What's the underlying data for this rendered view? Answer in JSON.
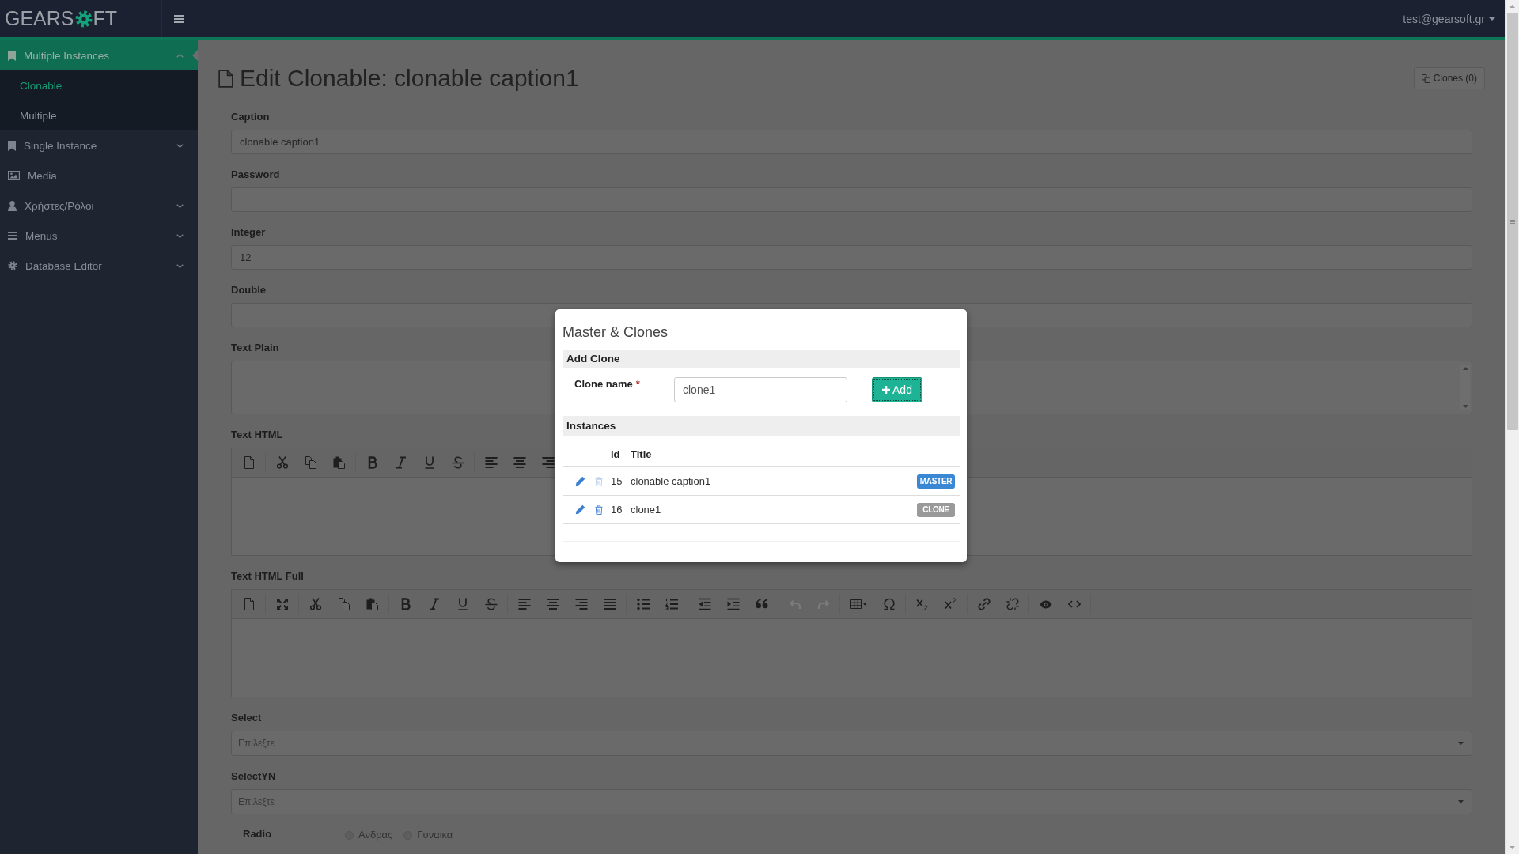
{
  "topbar": {
    "brand": {
      "text_start": "GEARS",
      "text_end": "FT"
    },
    "user_menu": "test@gearsoft.gr"
  },
  "sidebar": {
    "items": [
      {
        "label": "Multiple Instances",
        "kind": "group",
        "selected": true,
        "expanded": true,
        "children": [
          {
            "label": "Clonable",
            "selected": true
          },
          {
            "label": "Multiple",
            "selected": false
          }
        ]
      },
      {
        "label": "Single Instance",
        "kind": "group",
        "selected": false,
        "expanded": false
      },
      {
        "label": "Media",
        "kind": "link",
        "selected": false
      },
      {
        "label": "Χρήστες/Ρόλοι",
        "kind": "group",
        "selected": false,
        "expanded": false
      },
      {
        "label": "Menus",
        "kind": "group",
        "selected": false,
        "expanded": false
      },
      {
        "label": "Database Editor",
        "kind": "group",
        "selected": false,
        "expanded": false
      }
    ]
  },
  "page": {
    "title": "Edit Clonable: clonable caption1",
    "clones_button": "Clones (0)"
  },
  "form": {
    "fields": [
      {
        "label": "Caption",
        "kind": "input",
        "value": "clonable caption1"
      },
      {
        "label": "Password",
        "kind": "input"
      },
      {
        "label": "Integer",
        "kind": "input",
        "value": "12"
      },
      {
        "label": "Double",
        "kind": "input"
      },
      {
        "label": "Text Plain",
        "kind": "textarea"
      },
      {
        "label": "Text HTML",
        "kind": "editor"
      },
      {
        "label": "Text HTML Full",
        "kind": "editor_full",
        "undo": {
          "disabled": true
        },
        "redo": {
          "disabled": true
        }
      },
      {
        "label": "Select",
        "kind": "select",
        "placeholder": "Επιλεξτε"
      },
      {
        "label": "SelectYN",
        "kind": "select",
        "placeholder": "Επιλεξτε"
      },
      {
        "label": "Radio",
        "kind": "radio",
        "options": [
          {
            "label": "Ανδρας",
            "selected": false
          },
          {
            "label": "Γυναικα",
            "selected": false
          }
        ]
      }
    ]
  },
  "modal": {
    "title": "Master & Clones",
    "add_clone": {
      "heading": "Add Clone",
      "label": "Clone name",
      "required_mark": "*",
      "value": "clone1",
      "button": {
        "label": "Add",
        "focused": true
      }
    },
    "instances": {
      "heading": "Instances",
      "columns": [
        "id",
        "Title"
      ],
      "rows": [
        {
          "id": "15",
          "title": "clonable caption1",
          "kind": "master",
          "badge": "MASTER",
          "deletable": false
        },
        {
          "id": "16",
          "title": "clone1",
          "kind": "clone",
          "badge": "CLONE",
          "deletable": true
        }
      ]
    }
  }
}
